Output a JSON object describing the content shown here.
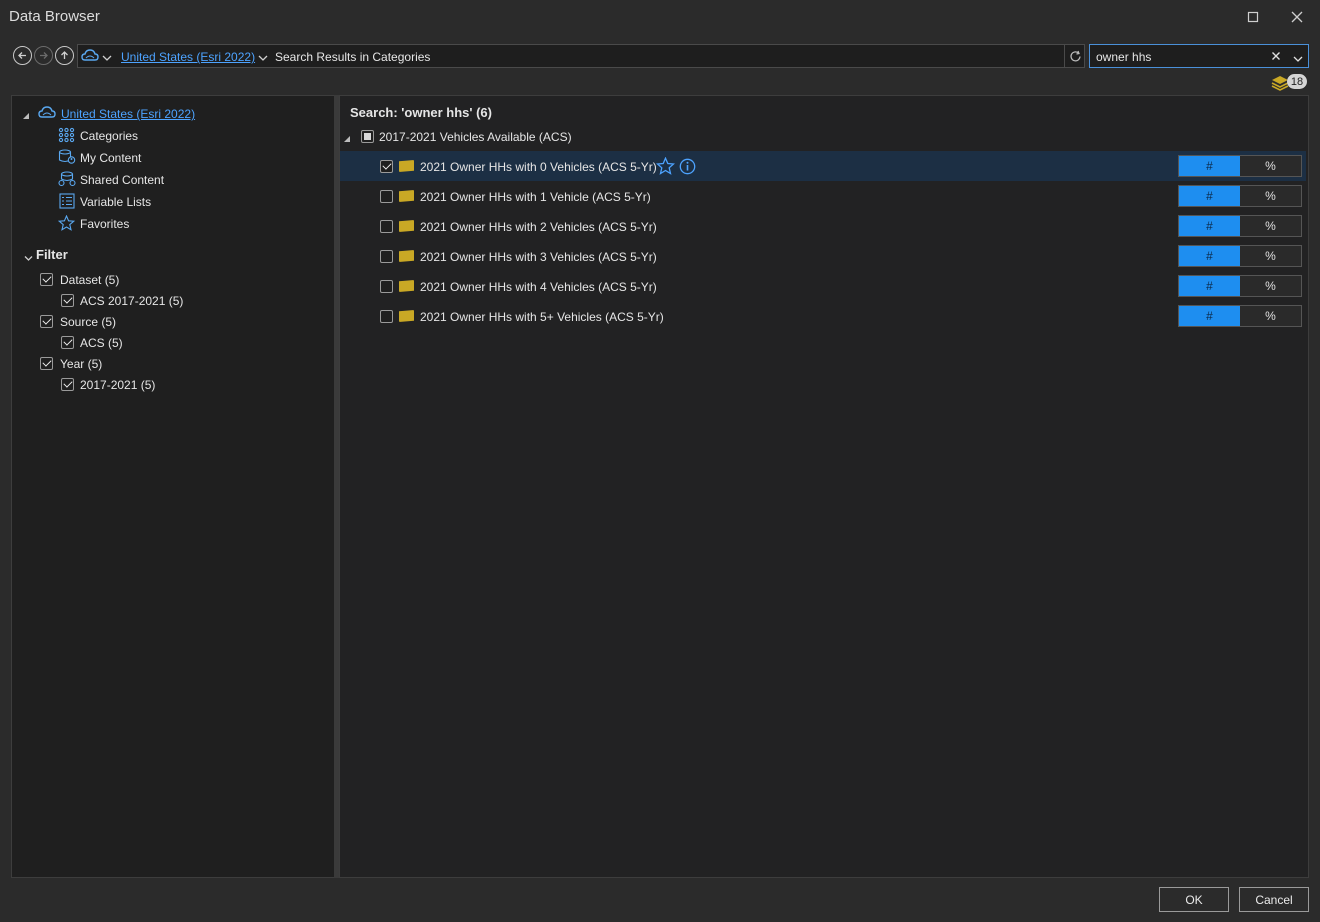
{
  "window": {
    "title": "Data Browser"
  },
  "nav": {
    "location_link": "United States (Esri 2022)",
    "path_text": "Search Results in Categories"
  },
  "search": {
    "value": "owner hhs"
  },
  "layers_badge": {
    "count": "18"
  },
  "left": {
    "root_label": "United States (Esri 2022)",
    "items": [
      {
        "label": "Categories",
        "icon": "grid-icon"
      },
      {
        "label": "My Content",
        "icon": "my-content-icon"
      },
      {
        "label": "Shared Content",
        "icon": "shared-content-icon"
      },
      {
        "label": "Variable Lists",
        "icon": "list-icon"
      },
      {
        "label": "Favorites",
        "icon": "star-icon"
      }
    ],
    "filter_header": "Filter",
    "filters": [
      {
        "label": "Dataset (5)",
        "checked": true,
        "child": "ACS 2017-2021 (5)"
      },
      {
        "label": "Source (5)",
        "checked": true,
        "child": "ACS (5)"
      },
      {
        "label": "Year (5)",
        "checked": true,
        "child": "2017-2021 (5)"
      }
    ]
  },
  "right": {
    "search_heading": "Search: 'owner hhs' (6)",
    "group_label": "2017-2021 Vehicles Available (ACS)",
    "rows": [
      {
        "label": "2021 Owner HHs with 0 Vehicles (ACS 5-Yr)",
        "checked": true,
        "selected": true
      },
      {
        "label": "2021 Owner HHs with 1 Vehicle (ACS 5-Yr)",
        "checked": false
      },
      {
        "label": "2021 Owner HHs with 2 Vehicles (ACS 5-Yr)",
        "checked": false
      },
      {
        "label": "2021 Owner HHs with 3 Vehicles (ACS 5-Yr)",
        "checked": false
      },
      {
        "label": "2021 Owner HHs with 4 Vehicles (ACS 5-Yr)",
        "checked": false
      },
      {
        "label": "2021 Owner HHs with 5+ Vehicles (ACS 5-Yr)",
        "checked": false
      }
    ],
    "toggle_count_label": "#",
    "toggle_percent_label": "%"
  },
  "footer": {
    "ok_label": "OK",
    "cancel_label": "Cancel"
  },
  "colors": {
    "accent": "#1e8ef0",
    "link": "#4da3ff",
    "folder": "#c9a825"
  }
}
